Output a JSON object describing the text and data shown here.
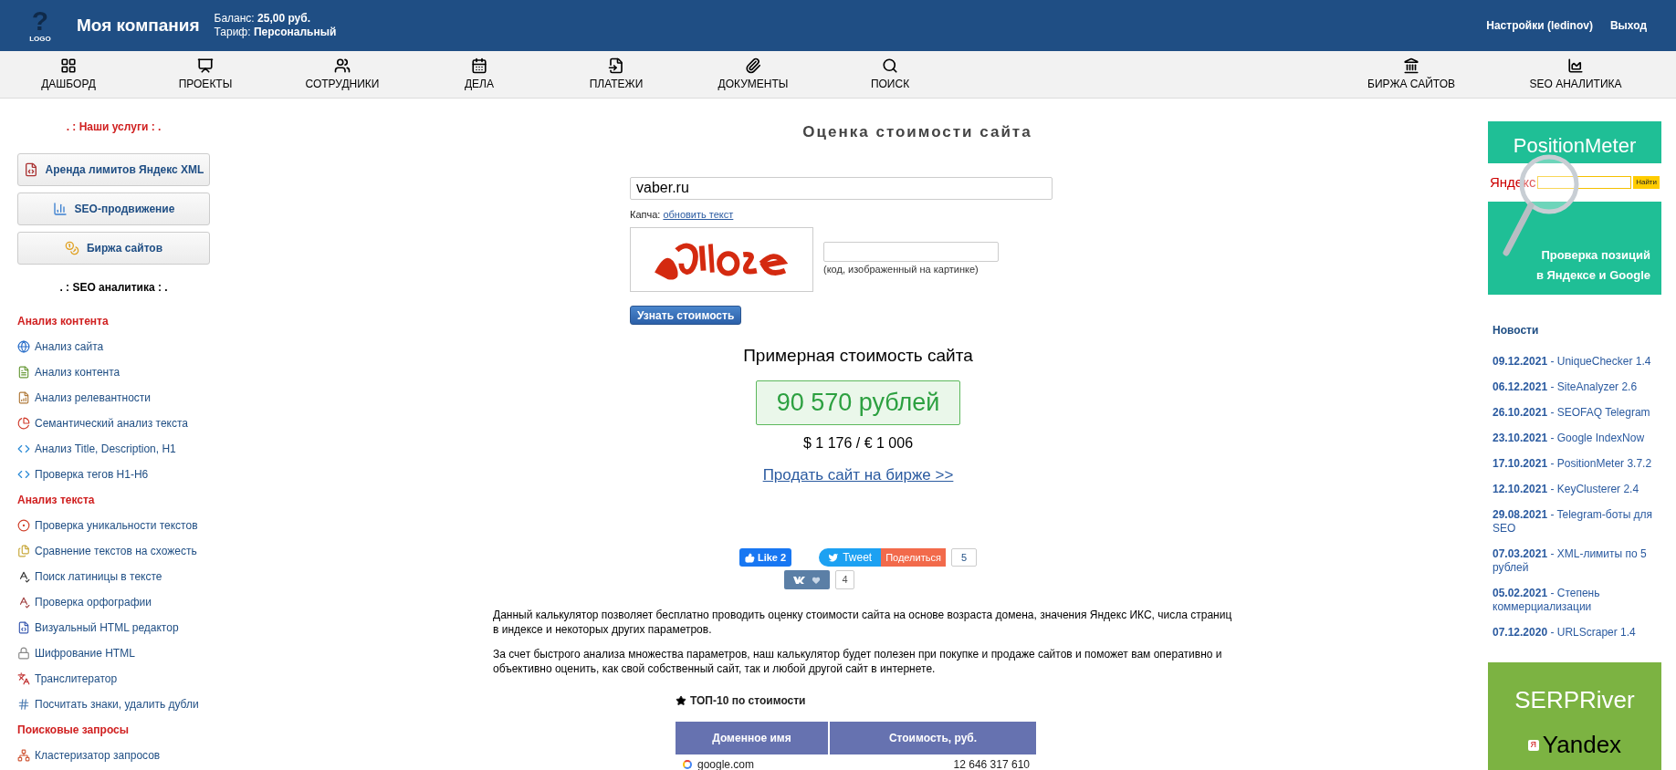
{
  "header": {
    "logo_text": "LOGO",
    "logo_mark": "?",
    "company": "Моя компания",
    "balance_label": "Баланс:",
    "balance": "25,00 руб.",
    "plan_label": "Тариф:",
    "plan": "Персональный",
    "settings": "Настройки (ledinov)",
    "logout": "Выход"
  },
  "nav": {
    "left": [
      {
        "label": "ДАШБОРД"
      },
      {
        "label": "ПРОЕКТЫ"
      },
      {
        "label": "СОТРУДНИКИ"
      },
      {
        "label": "ДЕЛА"
      },
      {
        "label": "ПЛАТЕЖИ"
      },
      {
        "label": "ДОКУМЕНТЫ"
      },
      {
        "label": "ПОИСК"
      }
    ],
    "right": [
      {
        "label": "БИРЖА САЙТОВ"
      },
      {
        "label": "SEO АНАЛИТИКА"
      }
    ]
  },
  "sidebar": {
    "services_title": ". : Наши услуги : .",
    "services": [
      {
        "label": "Аренда лимитов **Я**ндекс XML"
      },
      {
        "label": "SEO-продвижение"
      },
      {
        "label": "Биржа сайтов"
      }
    ],
    "analytics_title": ". : SEO аналитика : .",
    "groups": [
      {
        "title": "Анализ контента",
        "items": [
          "Анализ сайта",
          "Анализ контента",
          "Анализ релевантности",
          "Семантический анализ текста",
          "Анализ Title, Description, H1",
          "Проверка тегов H1-H6"
        ]
      },
      {
        "title": "Анализ текста",
        "items": [
          "Проверка уникальности текстов",
          "Сравнение текстов на схожесть",
          "Поиск латиницы в тексте",
          "Проверка орфографии",
          "Визуальный HTML редактор",
          "Шифрование HTML",
          "Транслитератор",
          "Посчитать знаки, удалить дубли"
        ]
      },
      {
        "title": "Поисковые запросы",
        "items": [
          "Кластеризатор запросов"
        ]
      }
    ]
  },
  "main": {
    "title": "Оценка стоимости сайта",
    "domain": "vaber.ru",
    "captcha_label": "Капча:",
    "captcha_refresh": "обновить текст",
    "captcha_hint": "(код, изображенный на картинке)",
    "submit": "Узнать стоимость",
    "result_title": "Примерная стоимость сайта",
    "price": "90 570 рублей",
    "price_other": "$ 1 176 / € 1 006",
    "sell_link": "Продать сайт на бирже >>",
    "social": {
      "like": "Like 2",
      "tweet": "Tweet",
      "share": "Поделиться",
      "share_count": "5",
      "vk_count": "4"
    },
    "paragraphs": [
      "Данный калькулятор позволяет бесплатно проводить оценку стоимости сайта на основе возраста домена, значения Яндекс ИКС, числа страниц в индексе и некоторых других параметров.",
      "За счет быстрого анализа множества параметров, наш калькулятор будет полезен при покупке и продаже сайтов и поможет вам оперативно и объективно оценить, как свой собственный сайт, так и любой другой сайт в интернете."
    ],
    "top_title": "ТОП-10 по стоимости",
    "table": {
      "columns": [
        "Доменное имя",
        "Стоимость, руб."
      ],
      "rows": [
        {
          "domain": "google.com",
          "price": "12 646 317 610"
        }
      ]
    }
  },
  "right": {
    "banner1": {
      "title": "PositionMeter",
      "search_brand": "Яндекс",
      "search_button": "Найти",
      "caption": [
        "Проверка позиций",
        "в Яндексе и Google"
      ]
    },
    "news_title": "Новости",
    "news": [
      {
        "text": "**09.12.2021** - UniqueChecker 1.4"
      },
      {
        "text": "**06.12.2021** - SiteAnalyzer 2.6"
      },
      {
        "text": "**26.10.2021** - SEOFAQ Telegram"
      },
      {
        "text": "**23.10.2021** - Google IndexNow"
      },
      {
        "text": "**17.10.2021** - PositionMeter 3.7.2"
      },
      {
        "text": "**12.10.2021** - KeyClusterer 2.4"
      },
      {
        "text": "**29.08.2021** - Telegram-боты для SEO"
      },
      {
        "text": "**07.03.2021** - XML-лимиты по 5 рублей"
      },
      {
        "text": "**05.02.2021** - Степень коммерциализации"
      },
      {
        "text": "**07.12.2020** - URLScraper 1.4"
      }
    ],
    "banner2": {
      "title": "SERPRiver",
      "brand_mark": "Я",
      "brand": "Yandex"
    }
  }
}
